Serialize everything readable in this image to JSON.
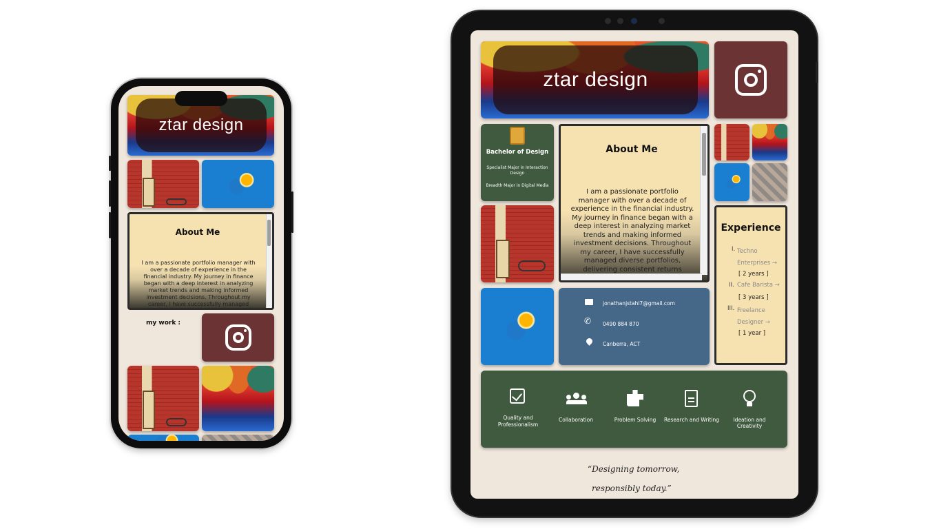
{
  "brand": {
    "title": "ztar design"
  },
  "phone": {
    "about_title": "About Me",
    "about_text": "I am a passionate portfolio manager with over a decade of experience in the financial industry. My journey in finance began with a deep interest in analyzing market trends and making informed investment decisions. Throughout my career, I have successfully managed",
    "my_work_label": "my work :"
  },
  "tablet": {
    "education": {
      "degree": "Bachelor of Design",
      "major1": "Specialist Major in Interaction Design",
      "major2": "Breadth Major in Digital Media"
    },
    "about_title": "About Me",
    "about_text": "I am a passionate portfolio manager with over a decade of experience in the financial industry. My journey in finance began with a deep interest in analyzing market trends and making informed investment decisions. Throughout my career, I have successfully managed diverse portfolios, delivering consistent returns",
    "experience": {
      "title": "Experience",
      "items": [
        {
          "num": "I.",
          "name": "Techno Enterprises →",
          "duration": "[ 2 years ]"
        },
        {
          "num": "II.",
          "name": "Cafe Barista →",
          "duration": "[ 3 years ]"
        },
        {
          "num": "III.",
          "name": "Freelance Designer →",
          "duration": "[ 1 year ]"
        }
      ]
    },
    "contact": {
      "email": "jonathanjstahl7@gmail.com",
      "phone": "0490 884 870",
      "location": "Canberra, ACT"
    },
    "skills": [
      {
        "label": "Quality and Professionalism",
        "icon": "checkbox-icon"
      },
      {
        "label": "Collaboration",
        "icon": "group-icon"
      },
      {
        "label": "Problem Solving",
        "icon": "puzzle-icon"
      },
      {
        "label": "Research and Writing",
        "icon": "document-icon"
      },
      {
        "label": "Ideation and Creativity",
        "icon": "lightbulb-icon"
      }
    ],
    "quote_line1": "“Designing tomorrow,",
    "quote_line2": "responsibly today.”"
  },
  "colors": {
    "background": "#efe6dc",
    "insta_tile": "#6b3333",
    "green_tile": "#3f5a3e",
    "blue_tile": "#466888",
    "card": "#f6e1b0"
  }
}
